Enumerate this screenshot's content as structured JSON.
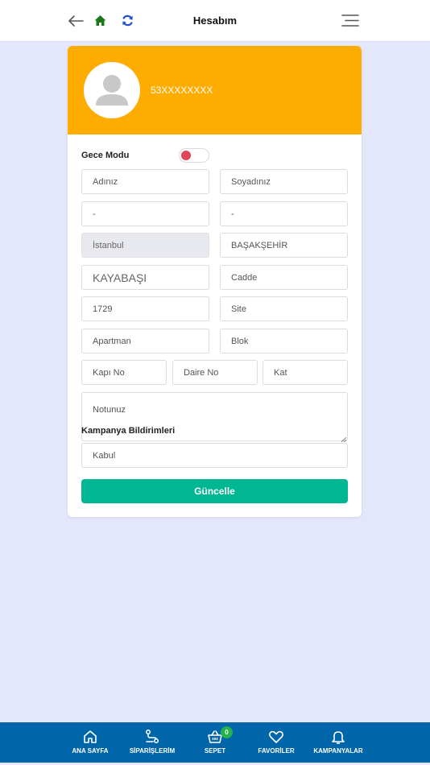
{
  "header": {
    "title": "Hesabım",
    "icons": [
      "back-arrow-icon",
      "home-icon",
      "sync-icon",
      "menu-icon"
    ],
    "home_icon_color": "#1a7a1a",
    "sync_icon_color": "#1e4fd6"
  },
  "profile": {
    "phone": "53XXXXXXXX",
    "header_color": "#ffac01"
  },
  "settings": {
    "night_mode_label": "Gece Modu",
    "night_mode_on": false,
    "toggle_knob_color": "#e2465a"
  },
  "form": {
    "first_name_placeholder": "Adınız",
    "last_name_placeholder": "Soyadınız",
    "field_a_value": "-",
    "field_b_value": "-",
    "city": "İstanbul",
    "district": "BAŞAKŞEHİR",
    "neighborhood": "KAYABAŞI",
    "street_placeholder": "Cadde",
    "street_no": "1729",
    "site_placeholder": "Site",
    "apartment_placeholder": "Apartman",
    "block_placeholder": "Blok",
    "door_no_placeholder": "Kapı No",
    "flat_no_placeholder": "Daire No",
    "floor_placeholder": "Kat",
    "note_placeholder": "Notunuz",
    "campaign_label": "Kampanya Bildirimleri",
    "campaign_value": "Kabul",
    "update_button": "Güncelle",
    "update_button_color": "#00b693"
  },
  "bottom_nav": {
    "bar_color": "#0065a9",
    "items": [
      {
        "label": "ANA SAYFA",
        "icon": "home-outline-icon"
      },
      {
        "label": "SİPARİŞLERİM",
        "icon": "route-icon"
      },
      {
        "label": "SEPET",
        "icon": "basket-icon",
        "badge": "0"
      },
      {
        "label": "FAVORİLER",
        "icon": "heart-icon"
      },
      {
        "label": "KAMPANYALAR",
        "icon": "bell-icon"
      }
    ]
  }
}
